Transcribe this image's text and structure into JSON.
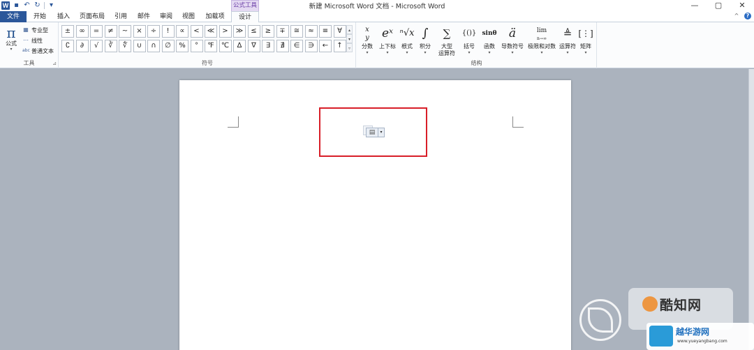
{
  "window": {
    "title": "新建 Microsoft Word 文档 - Microsoft Word",
    "controls": [
      "—",
      "▢",
      "✕"
    ]
  },
  "qat": {
    "logo": "W",
    "save": "💾",
    "undo": "↶",
    "redo": "↻",
    "more": "▾"
  },
  "context_tab_header": "公式工具",
  "tabs": [
    "文件",
    "开始",
    "插入",
    "页面布局",
    "引用",
    "邮件",
    "审阅",
    "视图",
    "加载项",
    "设计"
  ],
  "active_tab": "设计",
  "help": {
    "minimize_ribbon": "^",
    "help": "?"
  },
  "ribbon": {
    "tools": {
      "label": "工具",
      "equation": {
        "glyph": "π",
        "label": "公式"
      },
      "options": [
        {
          "icon": "⊞",
          "label": "专业型"
        },
        {
          "icon": "⋯",
          "label": "线性"
        },
        {
          "icon": "abc",
          "label": "普通文本"
        }
      ]
    },
    "symbols": {
      "label": "符号",
      "row1": [
        "±",
        "∞",
        "=",
        "≠",
        "~",
        "×",
        "÷",
        "!",
        "∝",
        "<",
        "≪",
        ">",
        "≫",
        "≤",
        "≥",
        "∓",
        "≅",
        "≈",
        "≡",
        "∀"
      ],
      "row2": [
        "∁",
        "∂",
        "√",
        "∛",
        "∜",
        "∪",
        "∩",
        "∅",
        "%",
        "°",
        "℉",
        "℃",
        "∆",
        "∇",
        "∃",
        "∄",
        "∈",
        "∋",
        "←",
        "↑"
      ]
    },
    "structures": {
      "label": "结构",
      "items": [
        {
          "glyph": "x/y",
          "label": "分数"
        },
        {
          "glyph": "eˣ",
          "label": "上下标"
        },
        {
          "glyph": "ⁿ√x",
          "label": "根式"
        },
        {
          "glyph": "∫",
          "label": "积分"
        },
        {
          "glyph": "∑",
          "label": "大型",
          "label2": "运算符"
        },
        {
          "glyph": "{()}",
          "label": "括号"
        },
        {
          "glyph": "sinθ",
          "label": "函数"
        },
        {
          "glyph": "ä",
          "label": "导数符号"
        },
        {
          "glyph": "lim",
          "label": "极限和对数"
        },
        {
          "glyph": "≜",
          "label": "运算符"
        },
        {
          "glyph": "[⋮]",
          "label": "矩阵"
        }
      ]
    }
  },
  "document": {
    "paste_options_icon": "📋"
  },
  "watermark": {
    "text1": "酷知网",
    "text2": "越华游网",
    "text3": "www.yueyangbang.com"
  }
}
